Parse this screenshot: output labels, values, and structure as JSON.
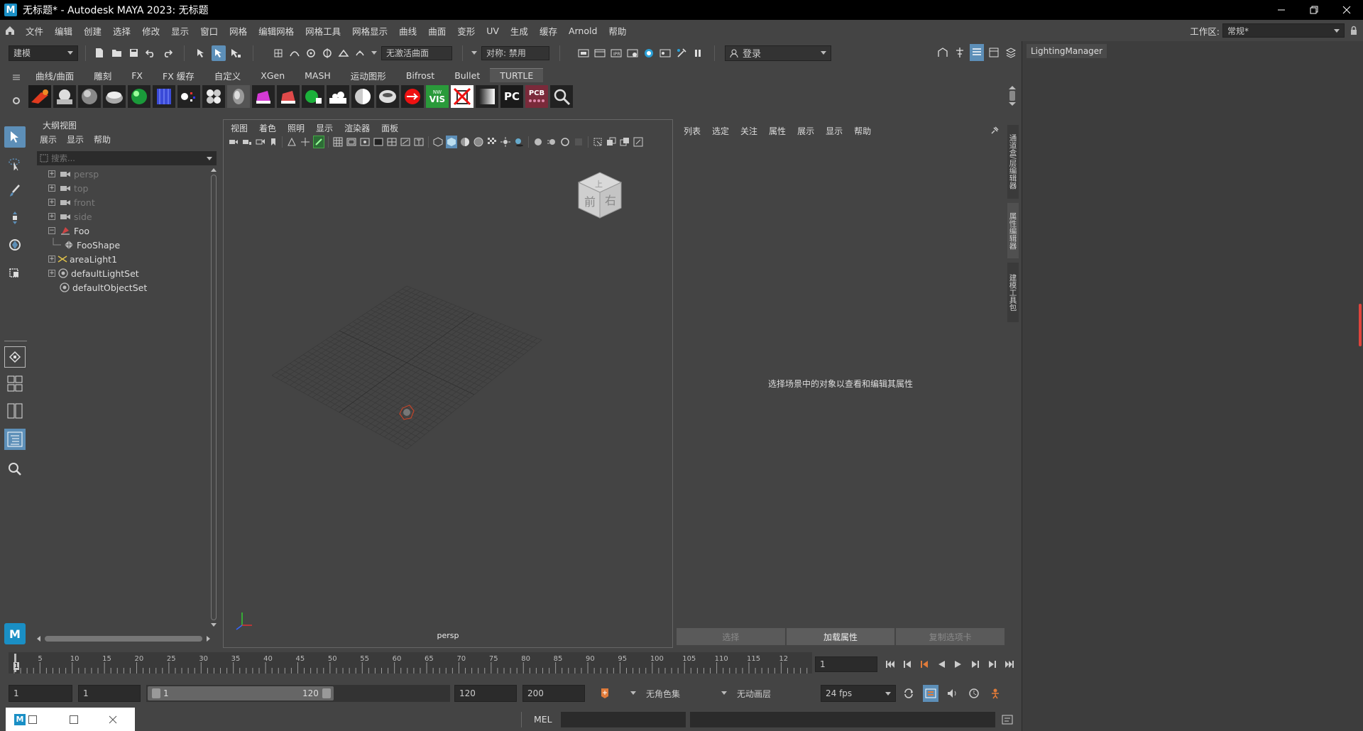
{
  "title_bar": {
    "app_icon": "M",
    "title": "无标题* - Autodesk MAYA 2023: 无标题"
  },
  "menu": {
    "items": [
      "文件",
      "编辑",
      "创建",
      "选择",
      "修改",
      "显示",
      "窗口",
      "网格",
      "编辑网格",
      "网格工具",
      "网格显示",
      "曲线",
      "曲面",
      "变形",
      "UV",
      "生成",
      "缓存",
      "Arnold",
      "帮助"
    ],
    "workspace_label": "工作区:",
    "workspace_value": "常规*"
  },
  "status_line": {
    "mode": "建模",
    "live_surface": "无激活曲面",
    "symmetry": "对称: 禁用",
    "login": "登录"
  },
  "shelf": {
    "tabs": [
      "曲线/曲面",
      "雕刻",
      "FX",
      "FX 缓存",
      "自定义",
      "XGen",
      "MASH",
      "运动图形",
      "Bifrost",
      "Bullet",
      "TURTLE"
    ],
    "active_tab": "TURTLE",
    "icon_labels": [
      "VIS",
      "PC",
      "PCB"
    ]
  },
  "outliner": {
    "title": "大纲视图",
    "menu": [
      "展示",
      "显示",
      "帮助"
    ],
    "search_placeholder": "搜索...",
    "items": [
      {
        "label": "persp"
      },
      {
        "label": "top"
      },
      {
        "label": "front"
      },
      {
        "label": "side"
      },
      {
        "label": "Foo"
      },
      {
        "label": "FooShape"
      },
      {
        "label": "areaLight1"
      },
      {
        "label": "defaultLightSet"
      },
      {
        "label": "defaultObjectSet"
      }
    ]
  },
  "viewport": {
    "menu": [
      "视图",
      "着色",
      "照明",
      "显示",
      "渲染器",
      "面板"
    ],
    "camera_label": "persp",
    "viewcube_front": "前",
    "viewcube_right": "右",
    "viewcube_top": "上"
  },
  "attribute_editor": {
    "menu": [
      "列表",
      "选定",
      "关注",
      "属性",
      "展示",
      "显示",
      "帮助"
    ],
    "empty_message": "选择场景中的对象以查看和编辑其属性",
    "buttons": [
      "选择",
      "加载属性",
      "复制选项卡"
    ]
  },
  "side_tabs": [
    "通道盒/层编辑器",
    "属性编辑器",
    "建模工具包"
  ],
  "lighting_manager": {
    "title": "LightingManager"
  },
  "time_slider": {
    "ticks": [
      "5",
      "10",
      "15",
      "20",
      "25",
      "30",
      "35",
      "40",
      "45",
      "50",
      "55",
      "60",
      "65",
      "70",
      "75",
      "80",
      "85",
      "90",
      "95",
      "100",
      "105",
      "110",
      "115",
      "12"
    ],
    "start_marker": "1",
    "current_frame": "1"
  },
  "range_slider": {
    "start": "1",
    "playback_start": "1",
    "range_left": "1",
    "range_right": "120",
    "playback_end": "120",
    "end": "200",
    "character_set": "无角色集",
    "anim_layer": "无动画层",
    "fps": "24 fps"
  },
  "command_line": {
    "lang": "MEL"
  },
  "taskbar": {
    "icon": "M"
  },
  "colors": {
    "accent": "#5d8fb8",
    "bg": "#444444",
    "dark": "#2b2b2b",
    "scroll_red": "#e0443c"
  }
}
